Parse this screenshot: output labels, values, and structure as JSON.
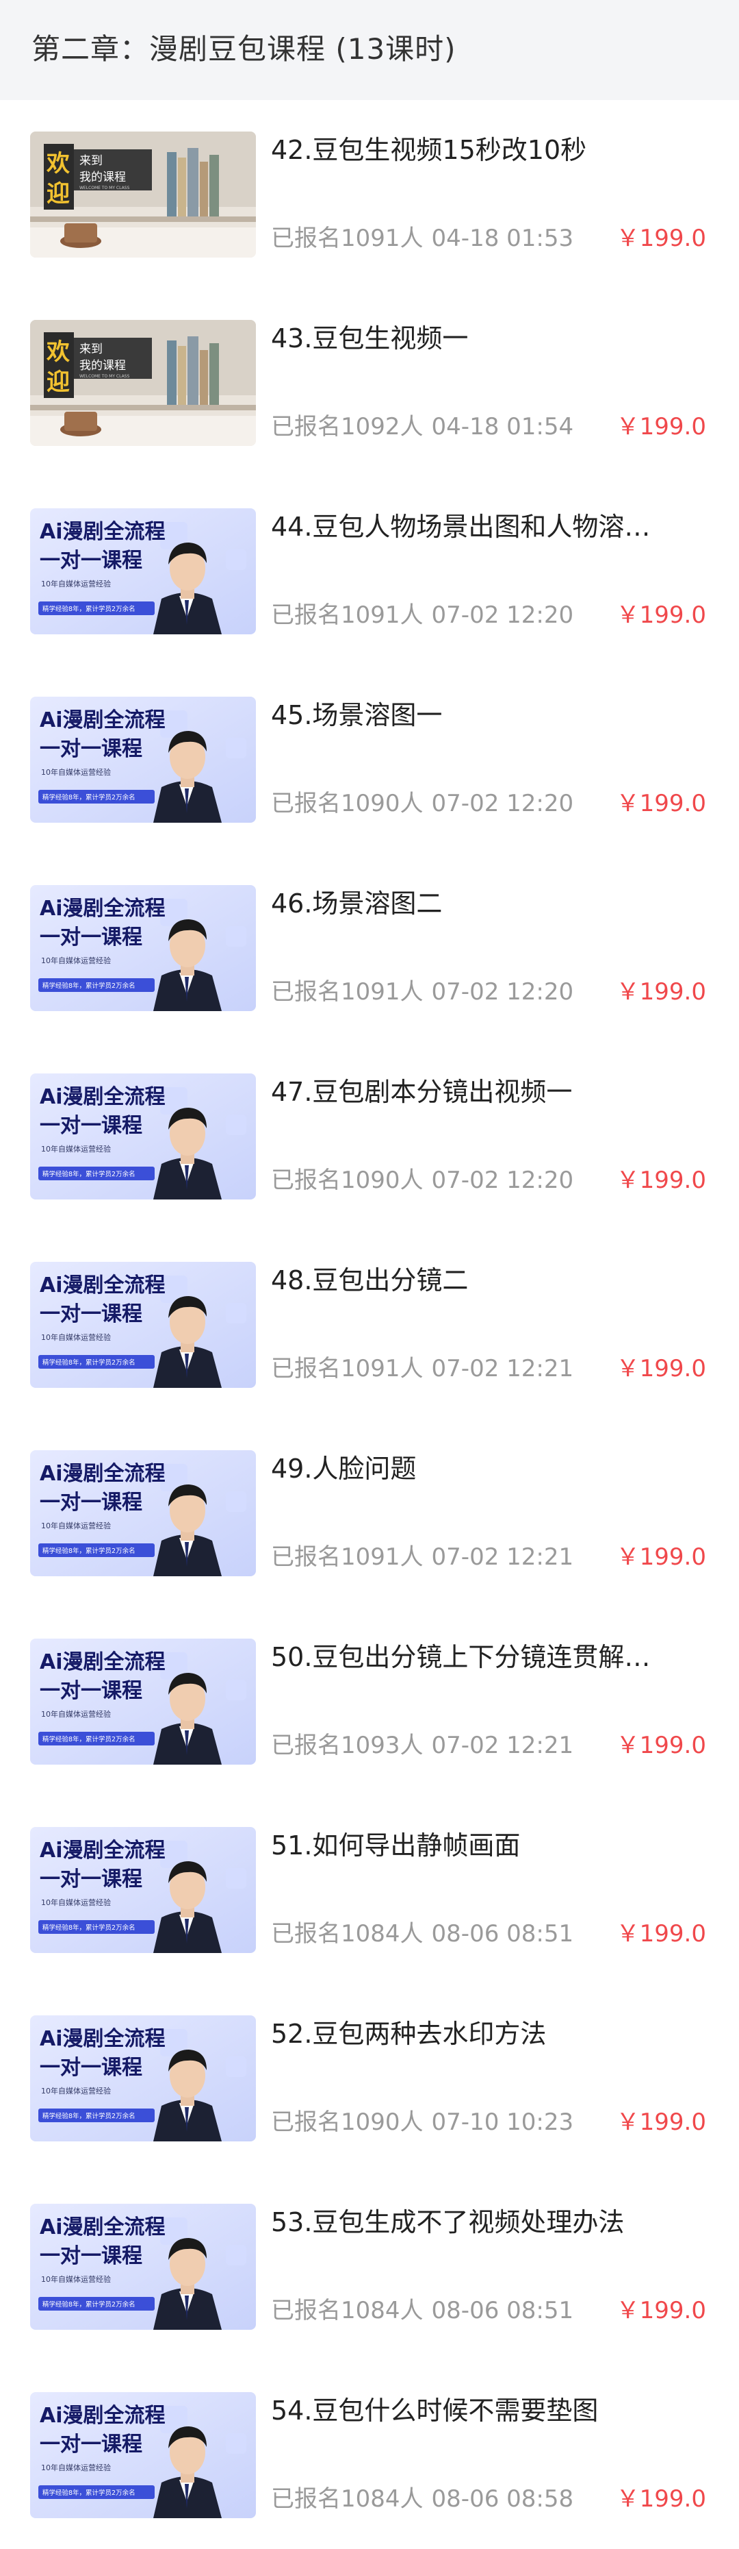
{
  "chapter": {
    "title": "第二章：漫剧豆包课程 (13课时)"
  },
  "thumbs": {
    "welcome": {
      "big": "欢迎",
      "to": "来到",
      "course": "我的课程",
      "small": "WELCOME TO MY CLASS"
    },
    "ai": {
      "line1": "Ai漫剧全流程",
      "line2": "一对一课程",
      "sub": "10年自媒体运营经验",
      "badge": "精学经验8年，累计学员2万余名"
    }
  },
  "courses": [
    {
      "thumb": "welcome",
      "title": "42.豆包生视频15秒改10秒",
      "enrolled": "已报名1091人",
      "date": "04-18 01:53",
      "price": "￥199.0"
    },
    {
      "thumb": "welcome",
      "title": "43.豆包生视频一",
      "enrolled": "已报名1092人",
      "date": "04-18 01:54",
      "price": "￥199.0"
    },
    {
      "thumb": "ai",
      "title": "44.豆包人物场景出图和人物溶…",
      "enrolled": "已报名1091人",
      "date": "07-02 12:20",
      "price": "￥199.0"
    },
    {
      "thumb": "ai",
      "title": "45.场景溶图一",
      "enrolled": "已报名1090人",
      "date": "07-02 12:20",
      "price": "￥199.0"
    },
    {
      "thumb": "ai",
      "title": "46.场景溶图二",
      "enrolled": "已报名1091人",
      "date": "07-02 12:20",
      "price": "￥199.0"
    },
    {
      "thumb": "ai",
      "title": "47.豆包剧本分镜出视频一",
      "enrolled": "已报名1090人",
      "date": "07-02 12:20",
      "price": "￥199.0"
    },
    {
      "thumb": "ai",
      "title": "48.豆包出分镜二",
      "enrolled": "已报名1091人",
      "date": "07-02 12:21",
      "price": "￥199.0"
    },
    {
      "thumb": "ai",
      "title": "49.人脸问题",
      "enrolled": "已报名1091人",
      "date": "07-02 12:21",
      "price": "￥199.0"
    },
    {
      "thumb": "ai",
      "title": "50.豆包出分镜上下分镜连贯解…",
      "enrolled": "已报名1093人",
      "date": "07-02 12:21",
      "price": "￥199.0"
    },
    {
      "thumb": "ai",
      "title": "51.如何导出静帧画面",
      "enrolled": "已报名1084人",
      "date": "08-06 08:51",
      "price": "￥199.0"
    },
    {
      "thumb": "ai",
      "title": "52.豆包两种去水印方法",
      "enrolled": "已报名1090人",
      "date": "07-10 10:23",
      "price": "￥199.0"
    },
    {
      "thumb": "ai",
      "title": "53.豆包生成不了视频处理办法",
      "enrolled": "已报名1084人",
      "date": "08-06 08:51",
      "price": "￥199.0"
    },
    {
      "thumb": "ai",
      "title": "54.豆包什么时候不需要垫图",
      "enrolled": "已报名1084人",
      "date": "08-06 08:58",
      "price": "￥199.0"
    }
  ]
}
